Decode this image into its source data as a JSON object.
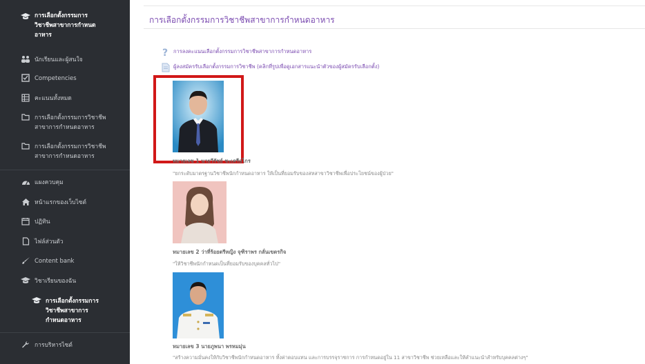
{
  "sidebar": {
    "items": [
      {
        "label": "การเลือกตั้งกรรมการ\nวิชาชีพสาขาการกำหนด\nอาหาร",
        "icon": "graduation-cap-icon"
      },
      {
        "label": "นักเรียนและผู้สนใจ",
        "icon": "users-icon"
      },
      {
        "label": "Competencies",
        "icon": "checkbox-icon"
      },
      {
        "label": "คะแนนทั้งหมด",
        "icon": "table-icon"
      },
      {
        "label": "การเลือกตั้งกรรมการวิชาชีพ\nสาขาการกำหนดอาหาร",
        "icon": "folder-icon"
      },
      {
        "label": "การเลือกตั้งกรรมการวิชาชีพ\nสาขาการกำหนดอาหาร",
        "icon": "folder-icon"
      },
      {
        "label": "แผงควบคุม",
        "icon": "dashboard-icon"
      },
      {
        "label": "หน้าแรกของเว็บไซต์",
        "icon": "home-icon"
      },
      {
        "label": "ปฏิทิน",
        "icon": "calendar-icon"
      },
      {
        "label": "ไฟล์ส่วนตัว",
        "icon": "file-icon"
      },
      {
        "label": "Content bank",
        "icon": "paintbrush-icon"
      },
      {
        "label": "วิชาเรียนของฉัน",
        "icon": "graduation-cap-icon"
      },
      {
        "label": "การเลือกตั้งกรรมการ\nวิชาชีพสาขาการ\nกำหนดอาหาร",
        "icon": "graduation-cap-icon"
      },
      {
        "label": "การบริหารไซต์",
        "icon": "wrench-icon"
      }
    ]
  },
  "main": {
    "title": "การเลือกตั้งกรรมการวิชาชีพสาขาการกำหนดอาหาร",
    "links": [
      {
        "text": "การลงคะแนนเลือกตั้งกรรมการวิชาชีพสาขาการกำหนดอาหาร",
        "icon": "question-icon"
      },
      {
        "text": "ผู้ลงสมัครรับเลือกตั้งกรรมการวิชาชีพ (คลิกที่รูปเพื่อดูเอกสารแนะนำตัวของผู้สมัครรับเลือกตั้ง)",
        "icon": "document-icon"
      }
    ],
    "candidates": [
      {
        "name": "หมายเลข 1  นายวีรัชย์  ชะเครือไกร",
        "quote": "\"ยกระดับมาตรฐานวิชาชีพนักกำหนดอาหาร ให้เป็นที่ยอมรับของสหสาขาวิชาชีพเพื่อประโยชน์ของผู้ป่วย\""
      },
      {
        "name": "หมายเลข 2  ว่าที่ร้อยตรีหญิง จุฑิราพร  กลั่นเขตรกิจ",
        "quote": "\"ให้วิชาชีพนักกำหนดเป็นที่ยอมรับของบุคคลทั่วไป\""
      },
      {
        "name": "หมายเลข 3  นายภูพนา  พรหมมุ่น",
        "quote": "\"สร้างความมั่นคงให้กับวิชาชีพนักกำหนดอาหาร ทั้งค่าตอบแทน และการบรรจุราชการ การกำหนดอยู่ใน 11 สาขาวิชาชีพ ช่วยเหลือและให้คำแนะนำสำหรับบุคคลต่างๆ\""
      }
    ]
  }
}
